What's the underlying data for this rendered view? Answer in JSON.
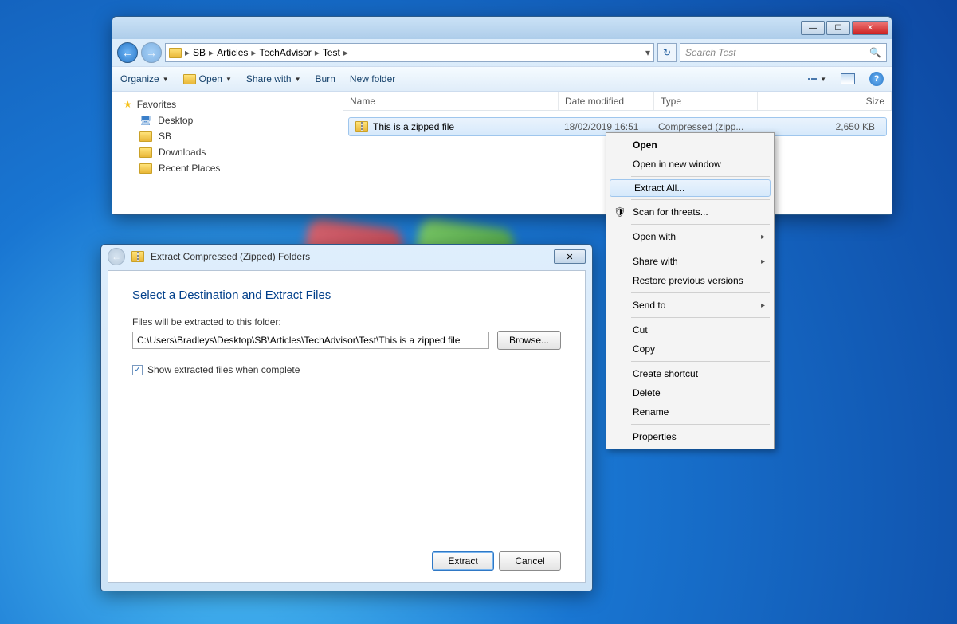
{
  "explorer": {
    "breadcrumb": [
      "SB",
      "Articles",
      "TechAdvisor",
      "Test"
    ],
    "search_placeholder": "Search Test",
    "toolbar": {
      "organize": "Organize",
      "open": "Open",
      "share": "Share with",
      "burn": "Burn",
      "newfolder": "New folder"
    },
    "sidebar": {
      "favorites": "Favorites",
      "items": [
        "Desktop",
        "SB",
        "Downloads",
        "Recent Places"
      ]
    },
    "columns": {
      "name": "Name",
      "date": "Date modified",
      "type": "Type",
      "size": "Size"
    },
    "file": {
      "name": "This is a zipped file",
      "date": "18/02/2019 16:51",
      "type": "Compressed (zipp...",
      "size": "2,650 KB"
    }
  },
  "context_menu": {
    "open": "Open",
    "open_new": "Open in new window",
    "extract_all": "Extract All...",
    "scan": "Scan for threats...",
    "open_with": "Open with",
    "share_with": "Share with",
    "restore": "Restore previous versions",
    "send_to": "Send to",
    "cut": "Cut",
    "copy": "Copy",
    "shortcut": "Create shortcut",
    "delete": "Delete",
    "rename": "Rename",
    "properties": "Properties"
  },
  "dialog": {
    "title": "Extract Compressed (Zipped) Folders",
    "heading": "Select a Destination and Extract Files",
    "path_label": "Files will be extracted to this folder:",
    "path_value": "C:\\Users\\Bradleys\\Desktop\\SB\\Articles\\TechAdvisor\\Test\\This is a zipped file",
    "browse": "Browse...",
    "checkbox": "Show extracted files when complete",
    "extract": "Extract",
    "cancel": "Cancel"
  }
}
